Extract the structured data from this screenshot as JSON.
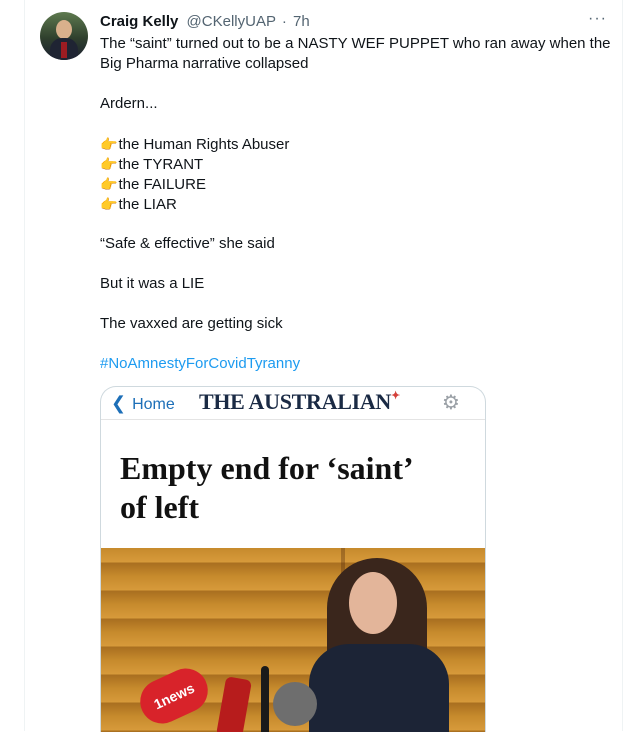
{
  "tweet": {
    "author_name": "Craig Kelly",
    "author_handle": "@CKellyUAP",
    "separator": "·",
    "time_ago": "7h",
    "more_label": "···",
    "line1": "The “saint” turned out to be a NASTY WEF PUPPET who ran away when the",
    "line2": "Big Pharma narrative collapsed",
    "ardern": "Ardern...",
    "list": [
      "the Human Rights Abuser",
      "the TYRANT",
      "the FAILURE",
      "the LIAR"
    ],
    "list_icon": "👉",
    "quote": "“Safe & effective” she said",
    "lie": "But it was a LIE",
    "sick": "The vaxxed are getting sick",
    "hashtag": "#NoAmnestyForCovidTyranny"
  },
  "card": {
    "back_label": "Home",
    "back_icon": "chevron-left-icon",
    "masthead": "THE AUSTRALIAN",
    "masthead_star": "✦",
    "gear_icon": "⚙",
    "headline_line1": "Empty end for ‘saint’",
    "headline_line2": "of left",
    "mic_label": "1news"
  }
}
